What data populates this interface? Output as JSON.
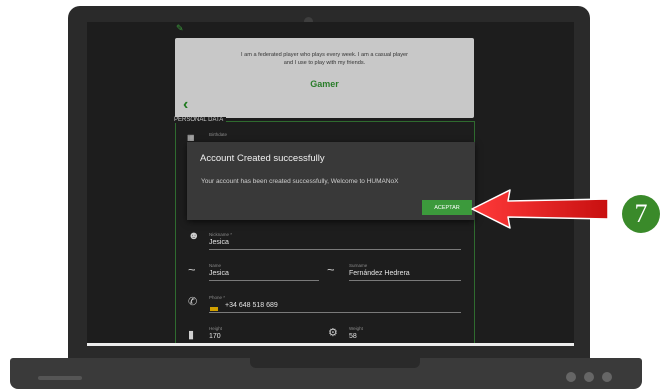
{
  "gamer": {
    "description": "I am a federated player who plays every week. I am a casual player\nand I use to play with my friends.",
    "title": "Gamer"
  },
  "personal": {
    "section_title": "PERSONAL DATA",
    "birthdate_label": "Birthdate",
    "nickname_label": "Nickname *",
    "nickname_value": "Jesica",
    "name_label": "Name",
    "name_value": "Jesica",
    "surname_label": "Surname",
    "surname_value": "Fernández Hedrera",
    "phone_label": "Phone *",
    "phone_value": "+34 648 518 689",
    "height_label": "Height",
    "height_value": "170",
    "weight_label": "Weight",
    "weight_value": "58"
  },
  "modal": {
    "title": "Account Created successfully",
    "message": "Your account has been created successfully, Welcome to HUMANoX",
    "accept_label": "ACEPTAR"
  },
  "annotation": {
    "step_number": "7",
    "arrow_color": "#e02020",
    "badge_color": "#3a8a2a"
  },
  "colors": {
    "accent_green": "#3c9a3c",
    "screen_bg": "#1d1d1d"
  }
}
